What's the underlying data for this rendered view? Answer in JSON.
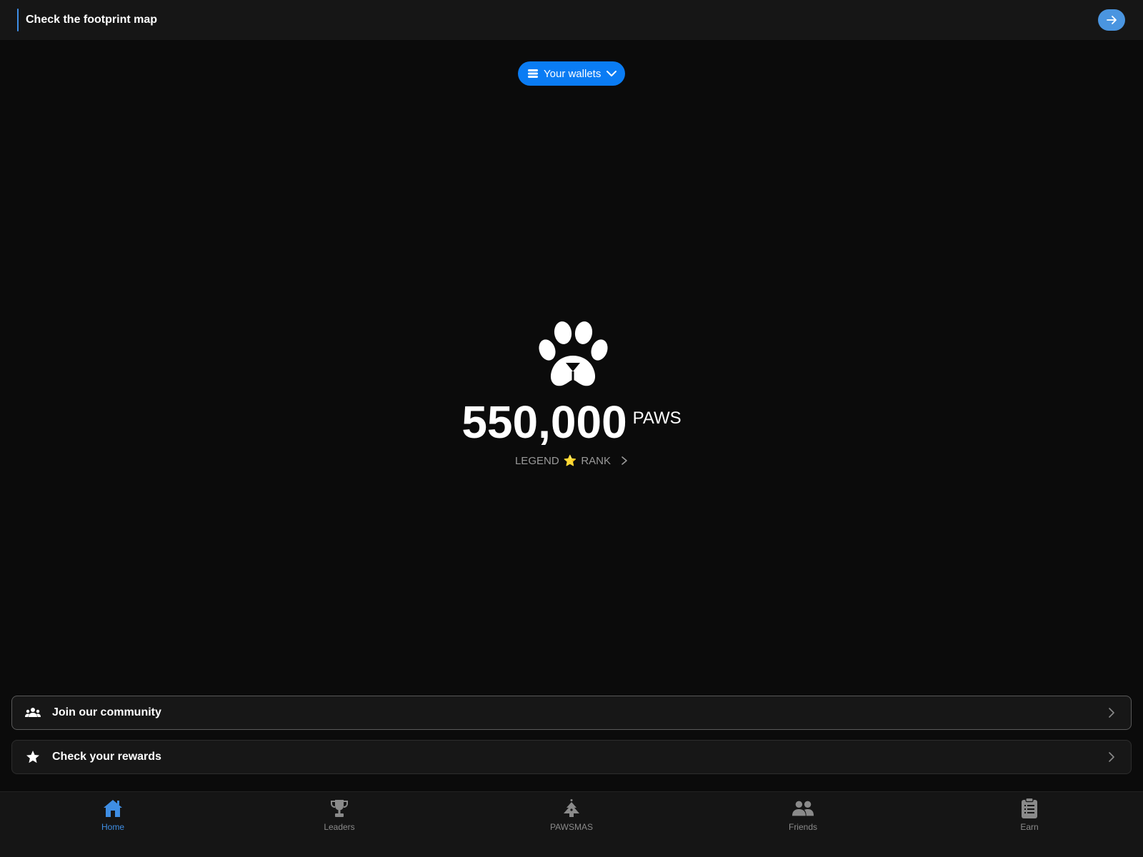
{
  "banner": {
    "title": "Check the footprint map",
    "arrow_icon": "arrow-right-icon"
  },
  "wallet": {
    "label": "Your wallets",
    "icon": "wallet-stack-icon",
    "chevron_icon": "chevron-down-icon"
  },
  "balance": {
    "value": "550,000",
    "unit": "PAWS"
  },
  "rank": {
    "prefix": "LEGEND",
    "star": "⭐",
    "suffix": "RANK"
  },
  "actions": [
    {
      "label": "Join our community",
      "icon": "community-icon"
    },
    {
      "label": "Check your rewards",
      "icon": "star-icon"
    }
  ],
  "nav": [
    {
      "label": "Home",
      "icon": "home-icon",
      "active": true
    },
    {
      "label": "Leaders",
      "icon": "trophy-icon",
      "active": false
    },
    {
      "label": "PAWSMAS",
      "icon": "tree-icon",
      "active": false
    },
    {
      "label": "Friends",
      "icon": "friends-icon",
      "active": false
    },
    {
      "label": "Earn",
      "icon": "clipboard-icon",
      "active": false
    }
  ],
  "colors": {
    "background": "#0b0b0b",
    "accent": "#0a7cf4",
    "active_nav": "#3f8ee4",
    "inactive_nav": "#8a8a8a"
  }
}
